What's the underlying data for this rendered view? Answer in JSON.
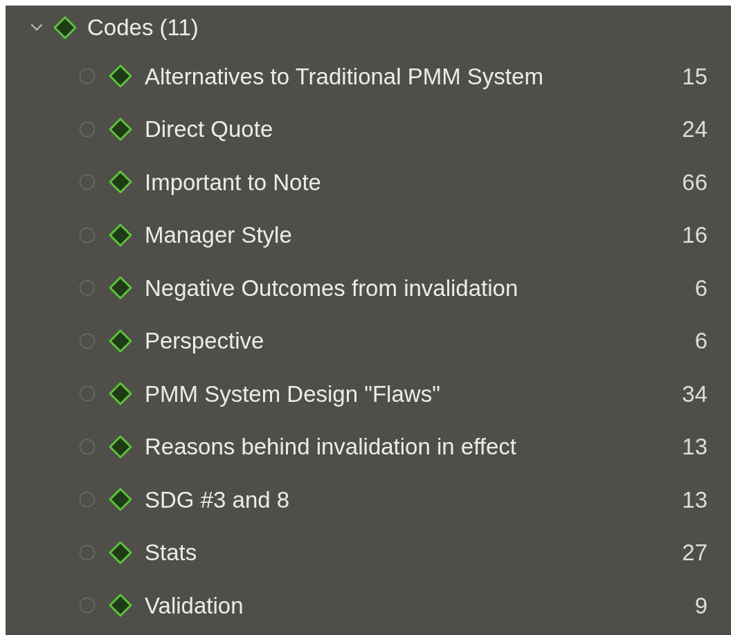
{
  "group": {
    "label": "Codes (11)",
    "expanded": true,
    "items": [
      {
        "label": "Alternatives to Traditional PMM System",
        "count": "15"
      },
      {
        "label": "Direct Quote",
        "count": "24"
      },
      {
        "label": "Important to Note",
        "count": "66"
      },
      {
        "label": "Manager Style",
        "count": "16"
      },
      {
        "label": "Negative Outcomes from invalidation",
        "count": "6"
      },
      {
        "label": "Perspective",
        "count": "6"
      },
      {
        "label": "PMM System Design \"Flaws\"",
        "count": "34"
      },
      {
        "label": "Reasons behind invalidation in effect",
        "count": "13"
      },
      {
        "label": "SDG #3 and 8",
        "count": "13"
      },
      {
        "label": "Stats",
        "count": "27"
      },
      {
        "label": "Validation",
        "count": "9"
      }
    ]
  }
}
